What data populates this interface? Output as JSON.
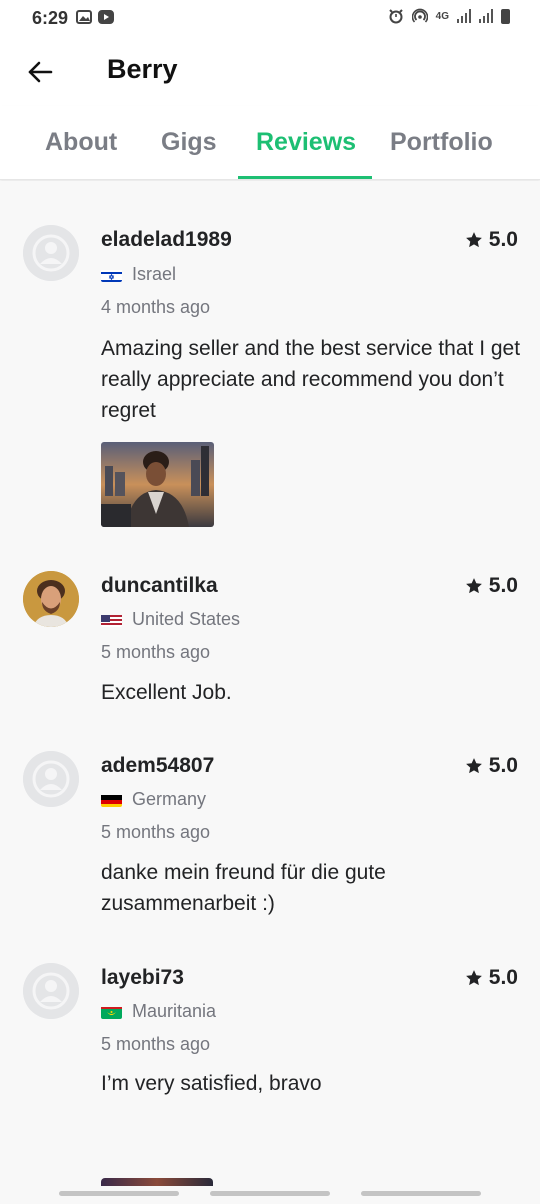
{
  "status_bar": {
    "time": "6:29",
    "network": "4G",
    "left_icons": [
      "image-icon",
      "youtube-icon"
    ],
    "right_icons": [
      "alarm-icon",
      "hotspot-icon",
      "signal-icon",
      "signal-icon",
      "battery-icon"
    ]
  },
  "header": {
    "back_icon": "arrow-left-icon",
    "title": "Berry"
  },
  "tabs": [
    {
      "label": "About",
      "active": false
    },
    {
      "label": "Gigs",
      "active": false
    },
    {
      "label": "Reviews",
      "active": true
    },
    {
      "label": "Portfolio",
      "active": false
    }
  ],
  "colors": {
    "accent": "#1dbf73",
    "text_primary": "#222325",
    "text_secondary": "#74767e",
    "background": "#f8f8f8"
  },
  "reviews": [
    {
      "username": "eladelad1989",
      "rating": "5.0",
      "country": "Israel",
      "flag": "israel-flag",
      "date": "4 months ago",
      "text": "Amazing seller and the best service that I get really appreciate and recommend you don’t regret",
      "avatar": "default-avatar-icon",
      "has_image": true
    },
    {
      "username": "duncantilka",
      "rating": "5.0",
      "country": "United States",
      "flag": "usa-flag",
      "date": "5 months ago",
      "text": "Excellent Job.",
      "avatar": "profile-photo",
      "has_image": false
    },
    {
      "username": "adem54807",
      "rating": "5.0",
      "country": "Germany",
      "flag": "germany-flag",
      "date": "5 months ago",
      "text": "danke mein freund für die gute zusammenarbeit :)",
      "avatar": "default-avatar-icon",
      "has_image": false
    },
    {
      "username": "layebi73",
      "rating": "5.0",
      "country": "Mauritania",
      "flag": "mauritania-flag",
      "date": "5 months ago",
      "text": "I’m very satisfied, bravo",
      "avatar": "default-avatar-icon",
      "has_image": false
    }
  ]
}
